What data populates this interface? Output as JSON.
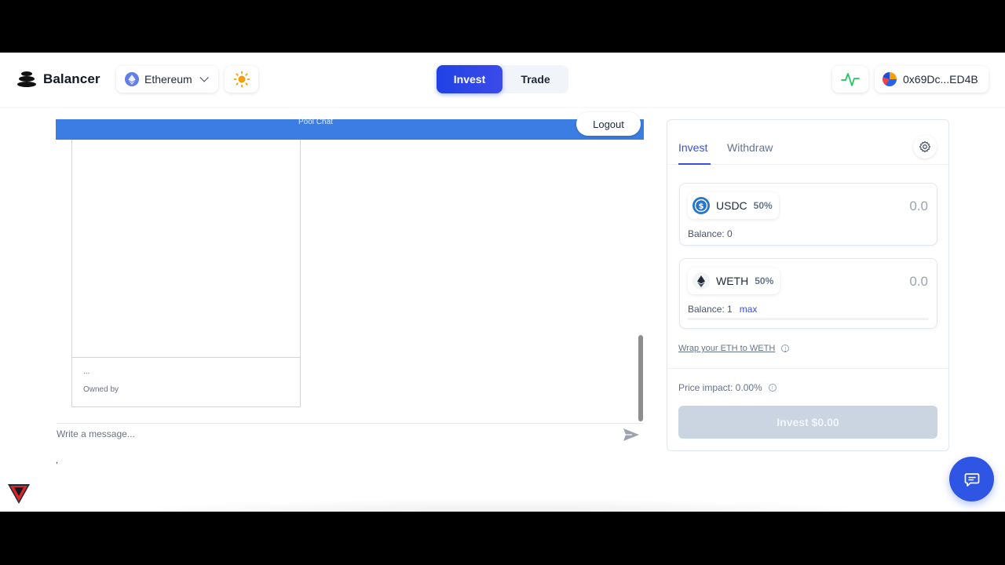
{
  "header": {
    "brand": "Balancer",
    "network": "Ethereum",
    "nav": [
      {
        "label": "Invest",
        "active": true
      },
      {
        "label": "Trade",
        "active": false
      }
    ],
    "account": "0x69Dc...ED4B",
    "accent_color": "#2042e6"
  },
  "chat": {
    "title": "Pool Chat",
    "logout_label": "Logout",
    "nft_dots": "...",
    "nft_owned": "Owned by",
    "message_placeholder": "Write a message...",
    "bar_color": "#3b7de3",
    "stray_char": ","
  },
  "invest_panel": {
    "tabs": [
      {
        "label": "Invest",
        "active": true
      },
      {
        "label": "Withdraw",
        "active": false
      }
    ],
    "tokens": [
      {
        "symbol": "USDC",
        "weight": "50%",
        "amount": "0.0",
        "balance_label": "Balance:",
        "balance": "0",
        "icon": "usdc-icon"
      },
      {
        "symbol": "WETH",
        "weight": "50%",
        "amount": "0.0",
        "balance_label": "Balance:",
        "balance": "1",
        "max_label": "max",
        "icon": "weth-icon"
      }
    ],
    "wrap_link": "Wrap your ETH to WETH",
    "price_impact": "Price impact: 0.00%",
    "invest_button": "Invest $0.00"
  }
}
